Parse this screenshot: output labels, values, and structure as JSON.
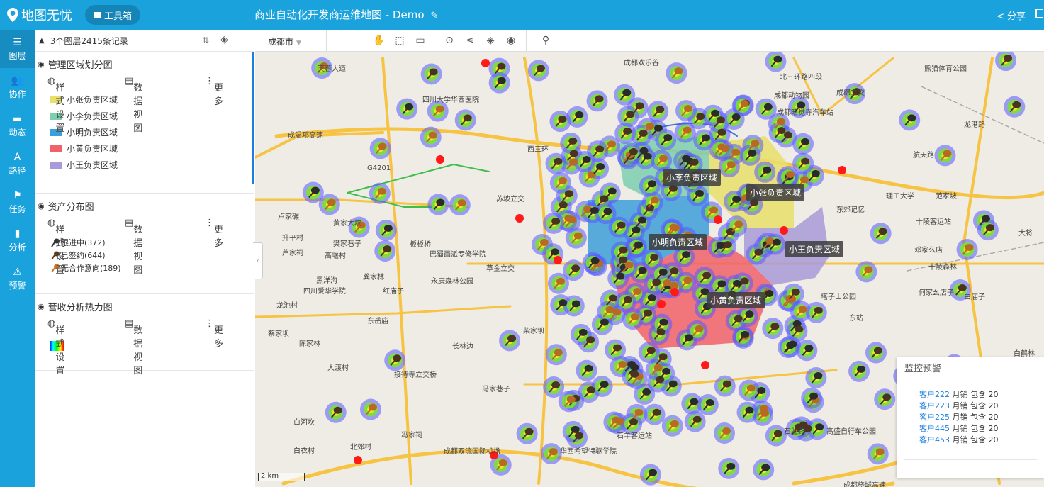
{
  "topbar": {
    "brand": "地图无忧",
    "toolbox": "工具箱",
    "map_title": "商业自动化开发商运维地图 - Demo",
    "share": "分享"
  },
  "leftnav": [
    {
      "label": "图层",
      "icon": "layers-icon",
      "glyph": "☰"
    },
    {
      "label": "协作",
      "icon": "users-icon",
      "glyph": "👥"
    },
    {
      "label": "动态",
      "icon": "chat-icon",
      "glyph": "▬"
    },
    {
      "label": "路径",
      "icon": "road-icon",
      "glyph": "A"
    },
    {
      "label": "任务",
      "icon": "flag-icon",
      "glyph": "⚑"
    },
    {
      "label": "分析",
      "icon": "bar-chart-icon",
      "glyph": "▮"
    },
    {
      "label": "预警",
      "icon": "warning-icon",
      "glyph": "⚠"
    }
  ],
  "panel": {
    "header": "3个图层2415条记录",
    "style_label": "样式设置",
    "data_view_label": "数据视图",
    "more_label": "更多",
    "groups": [
      {
        "title": "管理区域划分图",
        "legend": [
          {
            "label": "小张负责区域",
            "color": "#e8e06a"
          },
          {
            "label": "小李负责区域",
            "color": "#7ecfb0"
          },
          {
            "label": "小明负责区域",
            "color": "#3d9fd8"
          },
          {
            "label": "小黄负责区域",
            "color": "#f0626a"
          },
          {
            "label": "小王负责区域",
            "color": "#a99ad8"
          }
        ]
      },
      {
        "title": "资产分布图",
        "legend": [
          {
            "label": "跟进中(372)"
          },
          {
            "label": "已签约(644)"
          },
          {
            "label": "无合作意向(189)"
          }
        ]
      },
      {
        "title": "营收分析热力图"
      }
    ]
  },
  "map": {
    "city": "成都市",
    "scale": "2 km",
    "regions": [
      {
        "label": "小李负责区域"
      },
      {
        "label": "小张负责区域"
      },
      {
        "label": "小明负责区域"
      },
      {
        "label": "小王负责区域"
      },
      {
        "label": "小黄负责区域"
      }
    ],
    "places": [
      "成都欢乐谷",
      "芙蓉大道",
      "四川大学华西医院",
      "北三环路四段",
      "成都动物园",
      "成绵立交",
      "熊猫体育公园",
      "龙港路",
      "航天路",
      "成温邛高速",
      "G4201",
      "苏坡立交",
      "西三环",
      "卢家碾",
      "黄家大坟",
      "升平村",
      "樊家巷子",
      "芦家祠",
      "高堰村",
      "板板桥",
      "巴蜀画派专修学院",
      "草金立交",
      "黑洋沟",
      "龚家林",
      "四川爱华学院",
      "红庙子",
      "永康森林公园",
      "龙池村",
      "东岳庙",
      "蔡家坝",
      "陈家林",
      "长林边",
      "柴家坝",
      "大渡村",
      "接待寺立交桥",
      "冯家巷子",
      "白河坎",
      "冯家祠",
      "白衣村",
      "北郊村",
      "成都双流国际机场",
      "华西希望特驱学院",
      "石羊客运站",
      "塔子山公园",
      "东郊记忆",
      "十陵客运站",
      "邓家么店",
      "何家幺店子",
      "白庙子",
      "白鹤林",
      "高盛自行车公园",
      "石胜路",
      "成都绕城高速",
      "东站",
      "十陵森林",
      "成都昭觉寺汽车站",
      "理工大学",
      "范家坡",
      "大将"
    ],
    "monitor": {
      "title": "监控预警",
      "items": [
        {
          "customer": "客户222",
          "text": " 月销 包含 20"
        },
        {
          "customer": "客户223",
          "text": " 月销 包含 20"
        },
        {
          "customer": "客户225",
          "text": " 月销 包含 20"
        },
        {
          "customer": "客户445",
          "text": " 月销 包含 20"
        },
        {
          "customer": "客户453",
          "text": " 月销 包含 20"
        }
      ]
    }
  }
}
